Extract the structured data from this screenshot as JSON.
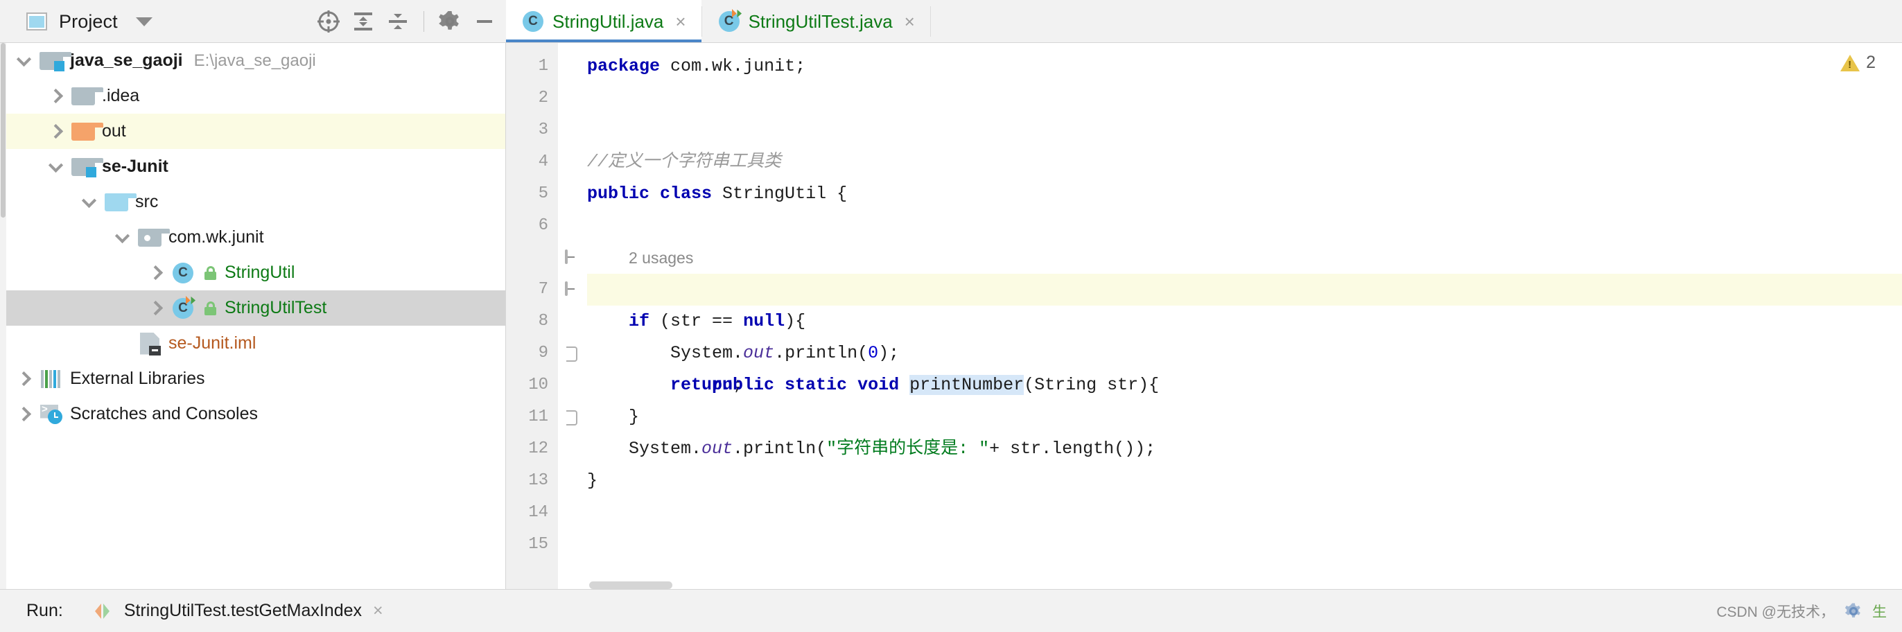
{
  "toolwindow": {
    "title": "Project",
    "icon": "project-window-icon",
    "dropdown_icon": "chevron-down-icon",
    "tools": [
      {
        "name": "locate-in-tree-icon",
        "label": "Select Opened File"
      },
      {
        "name": "expand-all-icon",
        "label": "Expand All"
      },
      {
        "name": "collapse-all-icon",
        "label": "Collapse All"
      },
      {
        "name": "gear-icon",
        "label": "Settings"
      },
      {
        "name": "minimize-icon",
        "label": "Hide"
      }
    ]
  },
  "tabs": [
    {
      "label": "StringUtil.java",
      "icon": "java-class-icon",
      "active": true,
      "has_run_marker": false,
      "close_icon": "×"
    },
    {
      "label": "StringUtilTest.java",
      "icon": "java-test-class-icon",
      "active": false,
      "has_run_marker": true,
      "close_icon": "×"
    }
  ],
  "tree": [
    {
      "label": "java_se_gaoji",
      "path": "E:\\java_se_gaoji",
      "icon": "module-folder-icon",
      "indent": 0,
      "expanded": true,
      "bold": true,
      "color": "default",
      "selected": "none"
    },
    {
      "label": ".idea",
      "path": "",
      "icon": "folder-gray-icon",
      "indent": 1,
      "expanded": false,
      "bold": false,
      "color": "default",
      "selected": "none"
    },
    {
      "label": "out",
      "path": "",
      "icon": "folder-orange-icon",
      "indent": 1,
      "expanded": false,
      "bold": false,
      "color": "default",
      "selected": "yellow"
    },
    {
      "label": "se-Junit",
      "path": "",
      "icon": "module-folder-icon",
      "indent": 1,
      "expanded": true,
      "bold": true,
      "color": "default",
      "selected": "none"
    },
    {
      "label": "src",
      "path": "",
      "icon": "source-root-folder-icon",
      "indent": 2,
      "expanded": true,
      "bold": false,
      "color": "default",
      "selected": "none"
    },
    {
      "label": "com.wk.junit",
      "path": "",
      "icon": "package-icon",
      "indent": 3,
      "expanded": true,
      "bold": false,
      "color": "default",
      "selected": "none"
    },
    {
      "label": "StringUtil",
      "path": "",
      "icon": "java-class-icon",
      "indent": 4,
      "expanded": false,
      "bold": false,
      "color": "green",
      "selected": "none"
    },
    {
      "label": "StringUtilTest",
      "path": "",
      "icon": "java-test-class-icon",
      "indent": 4,
      "expanded": false,
      "bold": false,
      "color": "green",
      "selected": "gray"
    },
    {
      "label": "se-Junit.iml",
      "path": "",
      "icon": "iml-file-icon",
      "indent": 3,
      "expanded": null,
      "bold": false,
      "color": "orange",
      "selected": "none"
    },
    {
      "label": "External Libraries",
      "path": "",
      "icon": "external-libraries-icon",
      "indent": 0,
      "expanded": false,
      "bold": false,
      "color": "default",
      "selected": "none"
    },
    {
      "label": "Scratches and Consoles",
      "path": "",
      "icon": "scratches-icon",
      "indent": 0,
      "expanded": false,
      "bold": false,
      "color": "default",
      "selected": "none"
    }
  ],
  "editor": {
    "line_numbers": [
      "1",
      "2",
      "3",
      "4",
      "5",
      "6",
      "7",
      "8",
      "9",
      "10",
      "11",
      "12",
      "13",
      "14",
      "15"
    ],
    "inlay_hint": "2 usages",
    "lightbulb_icon": "intention-bulb-icon",
    "gutter_run_icon": "run-method-icon",
    "warnings": {
      "count": "2",
      "icon": "warning-triangle-icon"
    },
    "code_lines": [
      "package com.wk.junit;",
      "",
      "",
      "//定义一个字符串工具类",
      "public class StringUtil {",
      "",
      "    public static void printNumber(String str){",
      "        if (str == null){",
      "            System.out.println(0);",
      "            return;",
      "        }",
      "        System.out.println(\"字符串的长度是: \"+ str.length());",
      "    }",
      "",
      ""
    ]
  },
  "status": {
    "run_label": "Run:",
    "run_config": "StringUtilTest.testGetMaxIndex",
    "run_config_icon": "run-configuration-icon",
    "close_icon": "×",
    "watermark": "CSDN @无技术，",
    "watermark_tail": "生",
    "watermark_icon": "gear-icon"
  }
}
